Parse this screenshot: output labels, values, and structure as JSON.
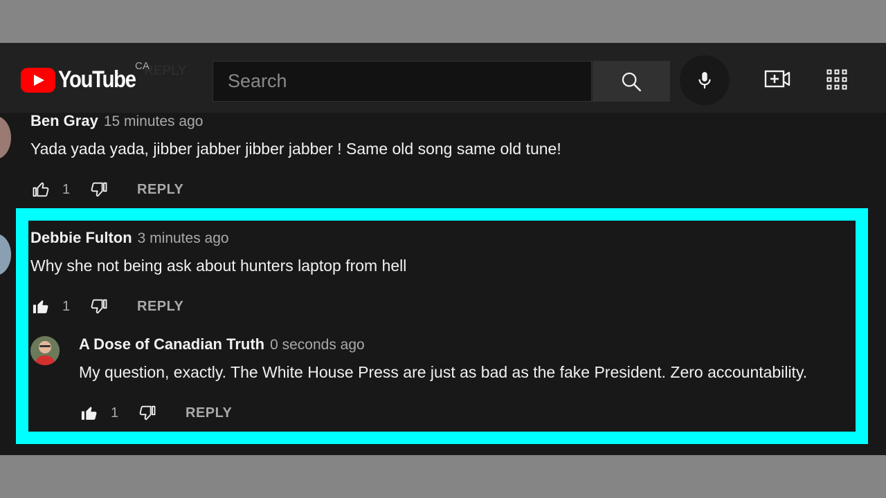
{
  "header": {
    "logo_text": "YouTube",
    "region": "CA",
    "search_placeholder": "Search"
  },
  "comments": [
    {
      "author": "Ben Gray",
      "time": "15 minutes ago",
      "text": "Yada yada yada,  jibber jabber jibber jabber ! Same old song same old tune!",
      "likes": "1",
      "liked": false,
      "reply_label": "REPLY"
    },
    {
      "author": "Debbie Fulton",
      "time": "3 minutes ago",
      "text": "Why she not being ask about hunters laptop from hell",
      "likes": "1",
      "liked": true,
      "reply_label": "REPLY"
    }
  ],
  "reply": {
    "author": "A Dose of Canadian Truth",
    "time": "0 seconds ago",
    "text": "My question, exactly. The White House Press are just as bad as the fake President. Zero accountability.",
    "likes": "1",
    "liked": true,
    "reply_label": "REPLY"
  },
  "colors": {
    "highlight": "#00ffff",
    "brand_red": "#ff0000",
    "background": "#181818"
  },
  "icons": [
    "youtube-logo-icon",
    "search-icon",
    "mic-icon",
    "create-video-icon",
    "apps-grid-icon",
    "thumbs-up-icon",
    "thumbs-down-icon"
  ]
}
